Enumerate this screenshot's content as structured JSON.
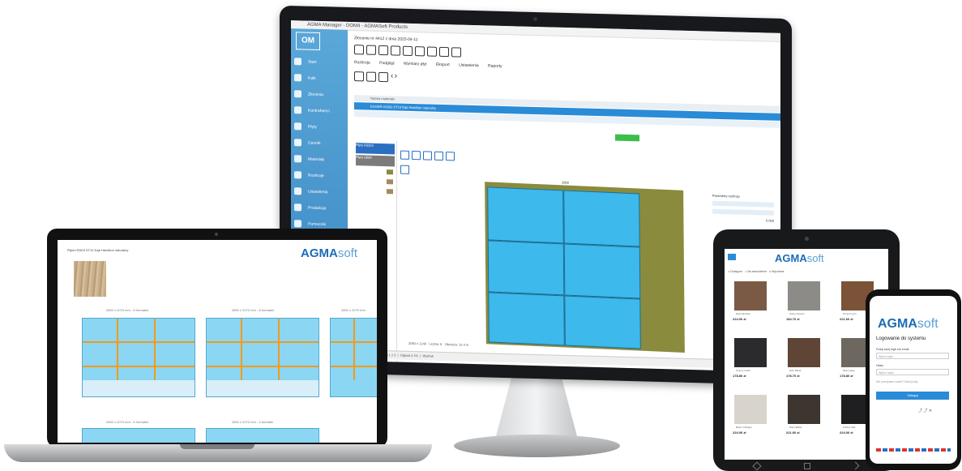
{
  "monitor": {
    "window_title": "AGMA Manager - DOM4 - AGMASoft Products",
    "subtitle": "Zlecenie nr 4412 z dnia 2025-04-11",
    "sidebar_logo": "OM",
    "sidebar_items": [
      "Start",
      "Kalk",
      "Zlecenia",
      "Kontrahenci",
      "Płyty",
      "Cennik",
      "Materiały",
      "Rozkroje",
      "Ustawienia",
      "Produkcja",
      "Pomocnik"
    ],
    "tabs": [
      "Rozkroje",
      "Podgląd",
      "Wymiary płyt",
      "Eksport",
      "Ustawienia",
      "Raporty"
    ],
    "grid_header": "Nazwa materiału",
    "grid_row": "EGGER H3303 ST10 Dąb Hamilton naturalny",
    "left_list": [
      "Płyta H3303",
      "Płyta U999",
      "Płyta W980",
      "Płyta F274"
    ],
    "status_items": [
      "Zapisano",
      "Rozkrój 1 z 3",
      "Odpad 4.1%",
      "Wydruk"
    ],
    "status_values": [
      "2050 x 1240",
      "Liczba: 6",
      "Obrzeża: 12.4 m"
    ],
    "right_panel_title": "Parametry rozkroju",
    "right_panel_value": "0.000",
    "sheet_label": "2800",
    "colors": {
      "accent": "#2a8bd7",
      "panel": "#3db9ec",
      "sheet": "#8a8b3c"
    }
  },
  "laptop": {
    "header_text": "Płyta H3303 ST10 Dąb Hamilton naturalny",
    "brand_bold": "AGMA",
    "brand_light": "soft",
    "captions": [
      "2800 x 2070 mm - 8 formatek",
      "2800 x 2070 mm - 8 formatek",
      "2800 x 2070 mm",
      "2800 x 2070 mm - 6 formatek",
      "2800 x 2070 mm - 4 formatki"
    ]
  },
  "tablet": {
    "brand_bold": "AGMA",
    "brand_light": "soft",
    "legend": [
      "Dostępne",
      "Na zamówienie",
      "Wycofane"
    ],
    "products": [
      {
        "name": "Dąb Hamilton",
        "price": "224.00 zł"
      },
      {
        "name": "Szary Kamień",
        "price": "184.70 zł"
      },
      {
        "name": "Orzech Lyon",
        "price": "221.60 zł"
      },
      {
        "name": "Czarny Grafit",
        "price": "178.80 zł"
      },
      {
        "name": "Dąb Tabak",
        "price": "178.70 zł"
      },
      {
        "name": "Dąb Lodge",
        "price": "178.80 zł"
      },
      {
        "name": "Beton Chicago",
        "price": "224.00 zł"
      },
      {
        "name": "Dąb Halifax",
        "price": "221.60 zł"
      },
      {
        "name": "Czarny Mat",
        "price": "224.00 zł"
      }
    ]
  },
  "phone": {
    "brand_bold": "AGMA",
    "brand_light": "soft",
    "login_title": "Logowanie do systemu",
    "login_label": "Podaj swój login lub email",
    "login_placeholder": "Wpisz login",
    "password_label": "Hasło",
    "password_placeholder": "Wpisz hasło",
    "forgot": "Nie pamiętasz hasła? Kliknij tutaj",
    "submit": "Zaloguj"
  }
}
